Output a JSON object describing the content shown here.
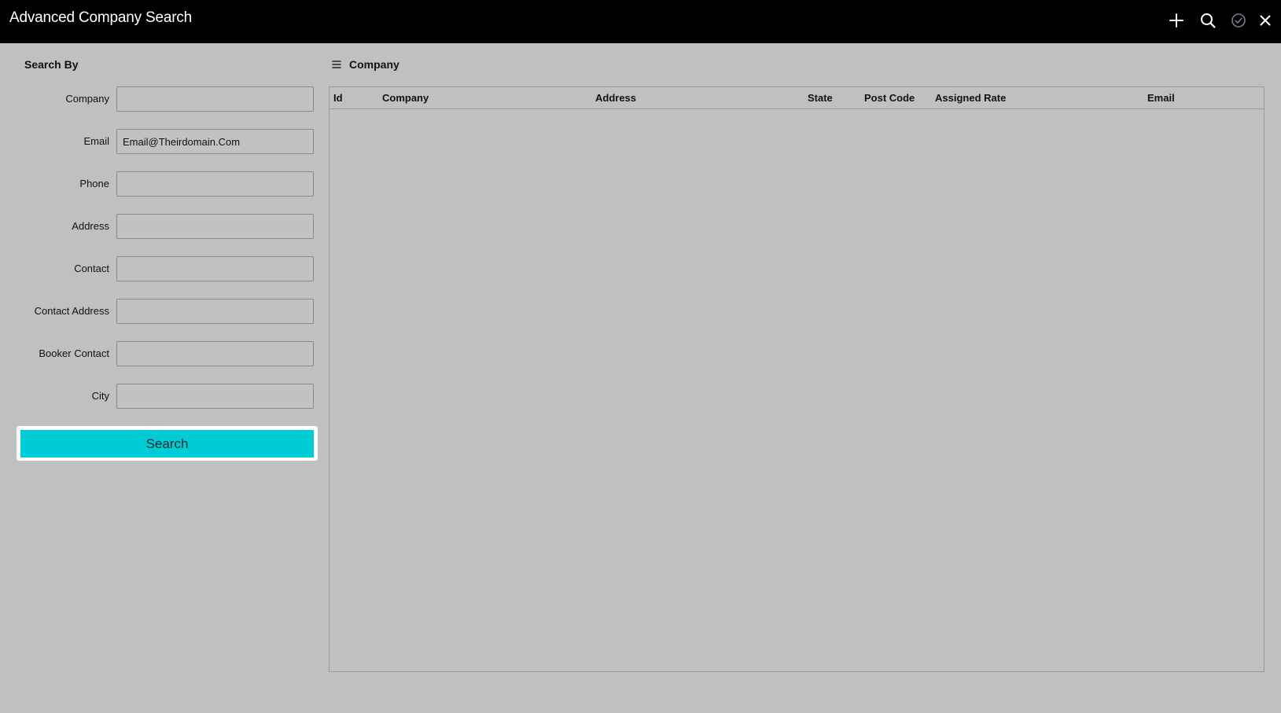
{
  "window": {
    "title": "Advanced Company Search",
    "toolbar_icons": [
      "plus-icon",
      "search-icon",
      "check-circle-icon",
      "close-icon"
    ]
  },
  "search_panel": {
    "title": "Search By",
    "fields": [
      {
        "label": "Company",
        "value": "",
        "placeholder": ""
      },
      {
        "label": "Email",
        "value": "Email@Theirdomain.Com",
        "placeholder": ""
      },
      {
        "label": "Phone",
        "value": "",
        "placeholder": ""
      },
      {
        "label": "Address",
        "value": "",
        "placeholder": ""
      },
      {
        "label": "Contact",
        "value": "",
        "placeholder": ""
      },
      {
        "label": "Contact Address",
        "value": "",
        "placeholder": ""
      },
      {
        "label": "Booker Contact",
        "value": "",
        "placeholder": ""
      },
      {
        "label": "City",
        "value": "",
        "placeholder": ""
      }
    ],
    "search_button_label": "Search"
  },
  "results_panel": {
    "title": "Company",
    "columns": [
      "Id",
      "Company",
      "Address",
      "State",
      "Post Code",
      "Assigned Rate",
      "Email"
    ],
    "rows": []
  },
  "colors": {
    "titlebar": "#000000",
    "background": "#c0c0c0",
    "accent": "#00ccd6"
  }
}
